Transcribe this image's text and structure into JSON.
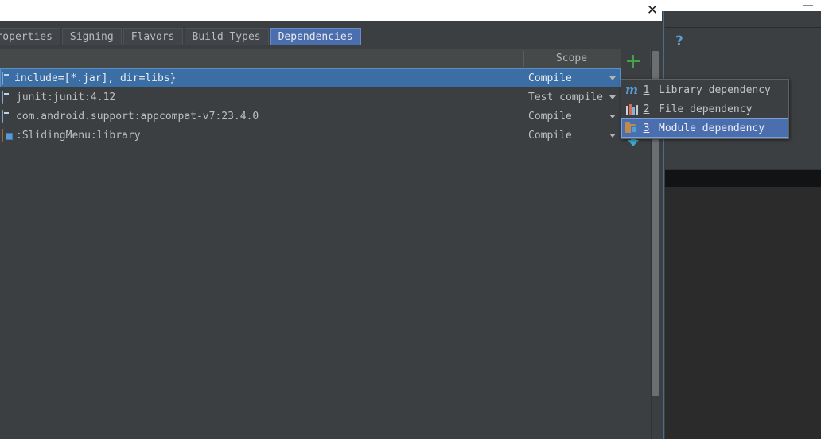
{
  "window": {
    "close_label": "✕",
    "minimize_label": "—"
  },
  "tabs": [
    {
      "label": "...roperties",
      "active": false
    },
    {
      "label": "Signing",
      "active": false
    },
    {
      "label": "Flavors",
      "active": false
    },
    {
      "label": "Build Types",
      "active": false
    },
    {
      "label": "Dependencies",
      "active": true
    }
  ],
  "table": {
    "headers": {
      "name": "",
      "scope": "Scope"
    },
    "rows": [
      {
        "label": "include=[*.jar], dir=libs}",
        "icon": "jar-icon",
        "scope": "Compile",
        "selected": true,
        "clipped": true
      },
      {
        "label": "junit:junit:4.12",
        "icon": "jar-icon",
        "scope": "Test compile",
        "selected": false,
        "clipped": false
      },
      {
        "label": "com.android.support:appcompat-v7:23.4.0",
        "icon": "jar-icon",
        "scope": "Compile",
        "selected": false,
        "clipped": false
      },
      {
        "label": ":SlidingMenu:library",
        "icon": "module-icon",
        "scope": "Compile",
        "selected": false,
        "clipped": false
      }
    ]
  },
  "toolbar": {
    "add_label": "+",
    "add_icon": "plus-icon",
    "down_icon": "arrow-down-icon"
  },
  "popup_menu": {
    "items": [
      {
        "number": "1",
        "label": "Library dependency",
        "icon": "maven-m-icon",
        "highlighted": false
      },
      {
        "number": "2",
        "label": "File dependency",
        "icon": "files-icon",
        "highlighted": false
      },
      {
        "number": "3",
        "label": "Module dependency",
        "icon": "module-folder-icon",
        "highlighted": true
      }
    ]
  },
  "ide_background": {
    "help_icon": "?",
    "help_icon_name": "help-icon"
  },
  "colors": {
    "dialog_bg": "#3c3f41",
    "selection_blue": "#3a6ea5",
    "menu_highlight": "#4b6eaf",
    "tab_active": "#4b6eaf",
    "plus_green": "#46a046",
    "accent_blue": "#5b9bd5",
    "editor_bg": "#2b2b2b"
  }
}
